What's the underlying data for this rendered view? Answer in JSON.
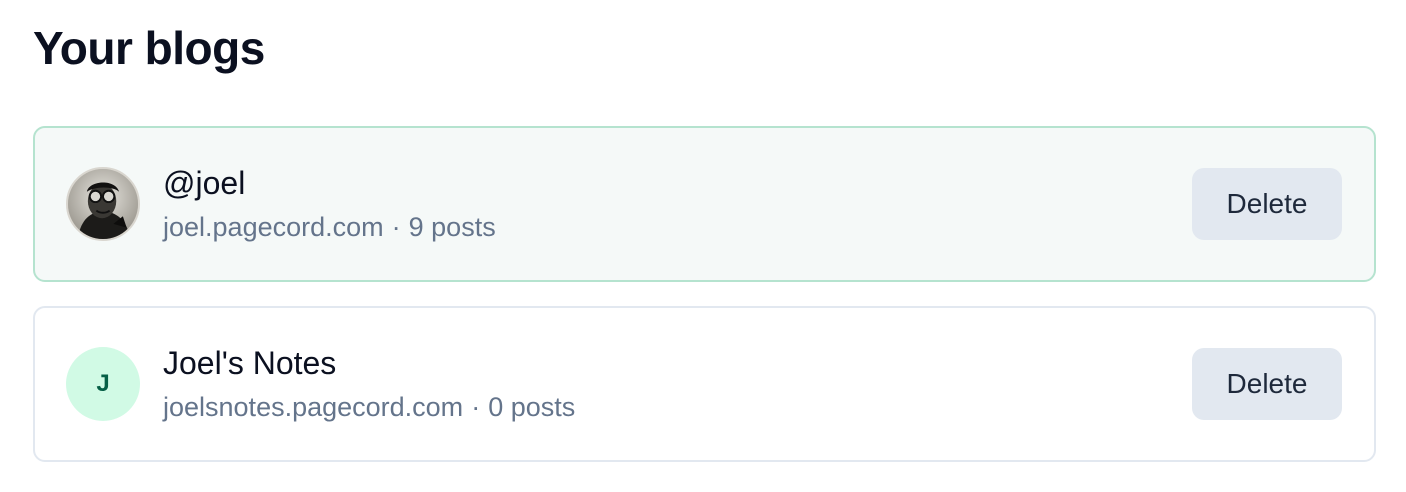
{
  "page": {
    "title": "Your blogs"
  },
  "blogs": [
    {
      "name": "@joel",
      "domain": "joel.pagecord.com",
      "separator": "·",
      "posts": "9 posts",
      "avatar": "photo",
      "delete_label": "Delete"
    },
    {
      "name": "Joel's Notes",
      "domain": "joelsnotes.pagecord.com",
      "separator": "·",
      "posts": "0 posts",
      "avatar_letter": "J",
      "delete_label": "Delete"
    }
  ],
  "colors": {
    "active_border": "#b5e3cf",
    "active_bg": "#f5f9f8",
    "avatar_letter_bg": "#d1fae5",
    "avatar_letter_fg": "#065f46",
    "delete_bg": "#e2e8f0"
  }
}
